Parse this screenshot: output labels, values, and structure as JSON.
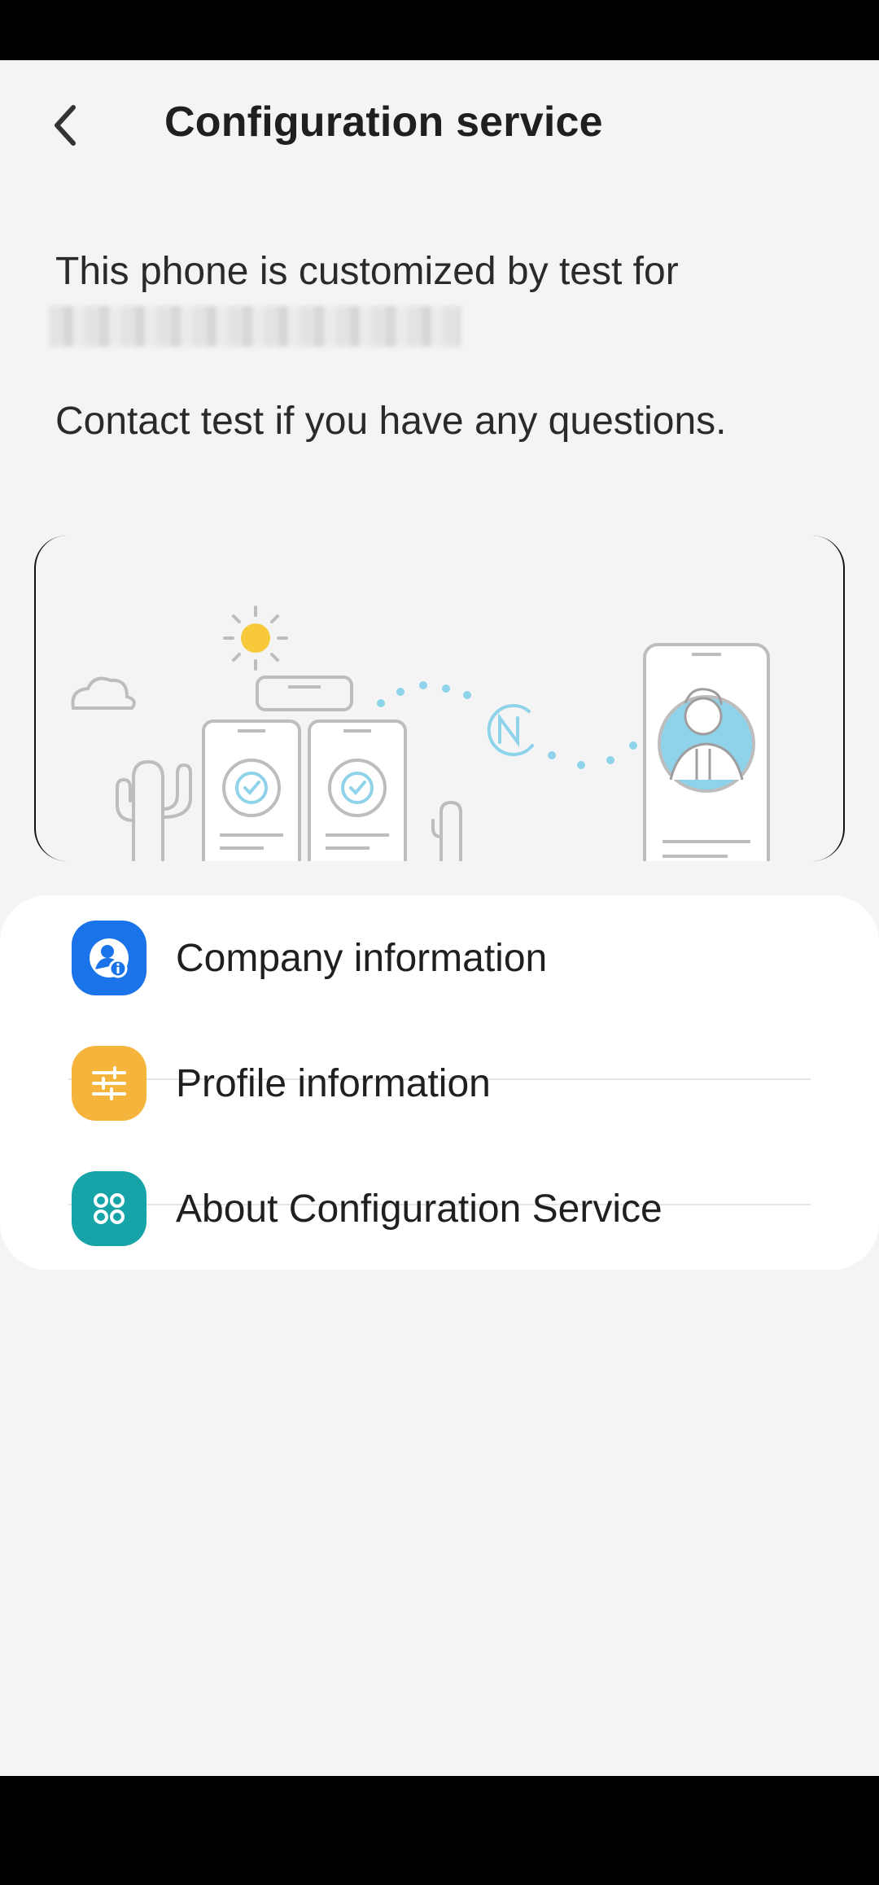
{
  "header": {
    "title": "Configuration service",
    "back_icon": "chevron-left-icon"
  },
  "intro": {
    "customized_text": "This phone is customized by test for",
    "contact_text": "Contact test if you have any questions."
  },
  "menu": {
    "items": [
      {
        "label": "Company information",
        "icon": "company-info-icon",
        "color": "#1a73e8"
      },
      {
        "label": "Profile information",
        "icon": "sliders-icon",
        "color": "#f5b43c"
      },
      {
        "label": "About Configuration Service",
        "icon": "apps-grid-icon",
        "color": "#16a4a8"
      }
    ]
  },
  "colors": {
    "background": "#f4f4f4",
    "card": "#ffffff",
    "accent_blue": "#1a73e8",
    "illustration_blue": "#8fd3ea",
    "sun_yellow": "#f8c93a"
  }
}
